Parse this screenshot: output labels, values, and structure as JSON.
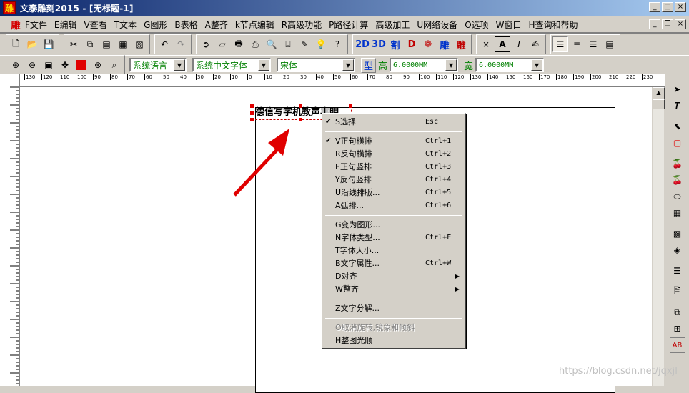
{
  "window": {
    "app_icon": "雕",
    "title": "文泰雕刻2015 - [无标题-1]",
    "buttons": [
      "_",
      "□",
      "×"
    ]
  },
  "menubar": {
    "icon": "雕",
    "items": [
      "F文件",
      "E编辑",
      "V查看",
      "T文本",
      "G图形",
      "B表格",
      "A整齐",
      "k节点编辑",
      "R高级功能",
      "P路径计算",
      "高级加工",
      "U网络设备",
      "O选项",
      "W窗口",
      "H查询和帮助"
    ],
    "mdi_buttons": [
      "_",
      "❐",
      "×"
    ]
  },
  "toolbar1": {
    "groups": [
      [
        "new-icon",
        "open-icon",
        "save-icon"
      ],
      [
        "cut-icon",
        "copy-icon",
        "paste-icon",
        "paste-special-icon",
        "clipboard-icon"
      ],
      [
        "undo-icon",
        "redo-icon"
      ],
      [
        "import-icon",
        "export-icon",
        "print-icon",
        "print-setup-icon",
        "preview-icon",
        "frame-icon",
        "pick-color-icon",
        "tip-icon",
        "help-icon"
      ]
    ],
    "special": [
      "2D",
      "3D",
      "割",
      "D",
      "雕",
      "雕"
    ],
    "text_tools": [
      "node-icon",
      "A",
      "I",
      "edit-icon"
    ],
    "align_tools": [
      "align-left-icon",
      "align-center-icon",
      "align-right-icon",
      "align-justify-icon"
    ]
  },
  "toolbar2": {
    "zoom_tools": [
      "zoom-in-icon",
      "zoom-out-icon",
      "zoom-page-icon",
      "pan-icon",
      "fill-color-icon",
      "zoom-fit-icon",
      "zoom-actual-icon"
    ],
    "language": "系统语言",
    "font_set": "系统中文字体",
    "font": "宋体",
    "type_label": "型",
    "height_label": "高",
    "height_value": "6.0000MM",
    "width_label": "宽",
    "width_value": "6.0000MM"
  },
  "ruler_h": [
    "130",
    "120",
    "110",
    "100",
    "90",
    "80",
    "70",
    "60",
    "50",
    "40",
    "30",
    "20",
    "10",
    "0",
    "10",
    "20",
    "30",
    "40",
    "50",
    "60",
    "70",
    "80",
    "90",
    "100",
    "110",
    "120",
    "130",
    "140",
    "150",
    "160",
    "170",
    "180",
    "190",
    "200",
    "210",
    "220",
    "230"
  ],
  "canvas": {
    "selected_text": "德信写字机教声丰明"
  },
  "context_menu": {
    "items": [
      {
        "label": "S选择",
        "shortcut": "Esc",
        "checked": true
      },
      {
        "sep": true
      },
      {
        "label": "V正句横排",
        "shortcut": "Ctrl+1",
        "checked": true
      },
      {
        "label": "R反句横排",
        "shortcut": "Ctrl+2"
      },
      {
        "label": "E正句竖排",
        "shortcut": "Ctrl+3"
      },
      {
        "label": "Y反句竖排",
        "shortcut": "Ctrl+4"
      },
      {
        "label": "U沿线排版...",
        "shortcut": "Ctrl+5"
      },
      {
        "label": "A弧排...",
        "shortcut": "Ctrl+6"
      },
      {
        "sep": true
      },
      {
        "label": "G变为图形..."
      },
      {
        "label": "N字体类型...",
        "shortcut": "Ctrl+F"
      },
      {
        "label": "T字体大小..."
      },
      {
        "label": "B文字属性...",
        "shortcut": "Ctrl+W"
      },
      {
        "label": "D对齐",
        "submenu": true
      },
      {
        "label": "W整齐",
        "submenu": true
      },
      {
        "sep": true
      },
      {
        "label": "Z文字分解..."
      },
      {
        "sep": true
      },
      {
        "label": "O取消旋转,镜象和倾斜",
        "disabled": true
      },
      {
        "label": "H整图光顺"
      }
    ]
  },
  "right_panel": [
    "pointer-icon",
    "text-tool-icon",
    "",
    "node-edit-icon",
    "rectangle-icon",
    "",
    "cherry-icon",
    "cherries-icon",
    "shape-icon",
    "table-icon",
    "",
    "palette-icon",
    "fill-icon",
    "",
    "align-icon",
    "",
    "page-icon",
    "",
    "layers-icon",
    "group-icon",
    "ab-icon"
  ],
  "watermark": "https://blog.csdn.net/jqxjl",
  "colors": {
    "title_start": "#0a246a",
    "title_end": "#a6caf0",
    "accent_red": "#d40000",
    "label_green": "#008000",
    "arrow_red": "#e00000"
  }
}
